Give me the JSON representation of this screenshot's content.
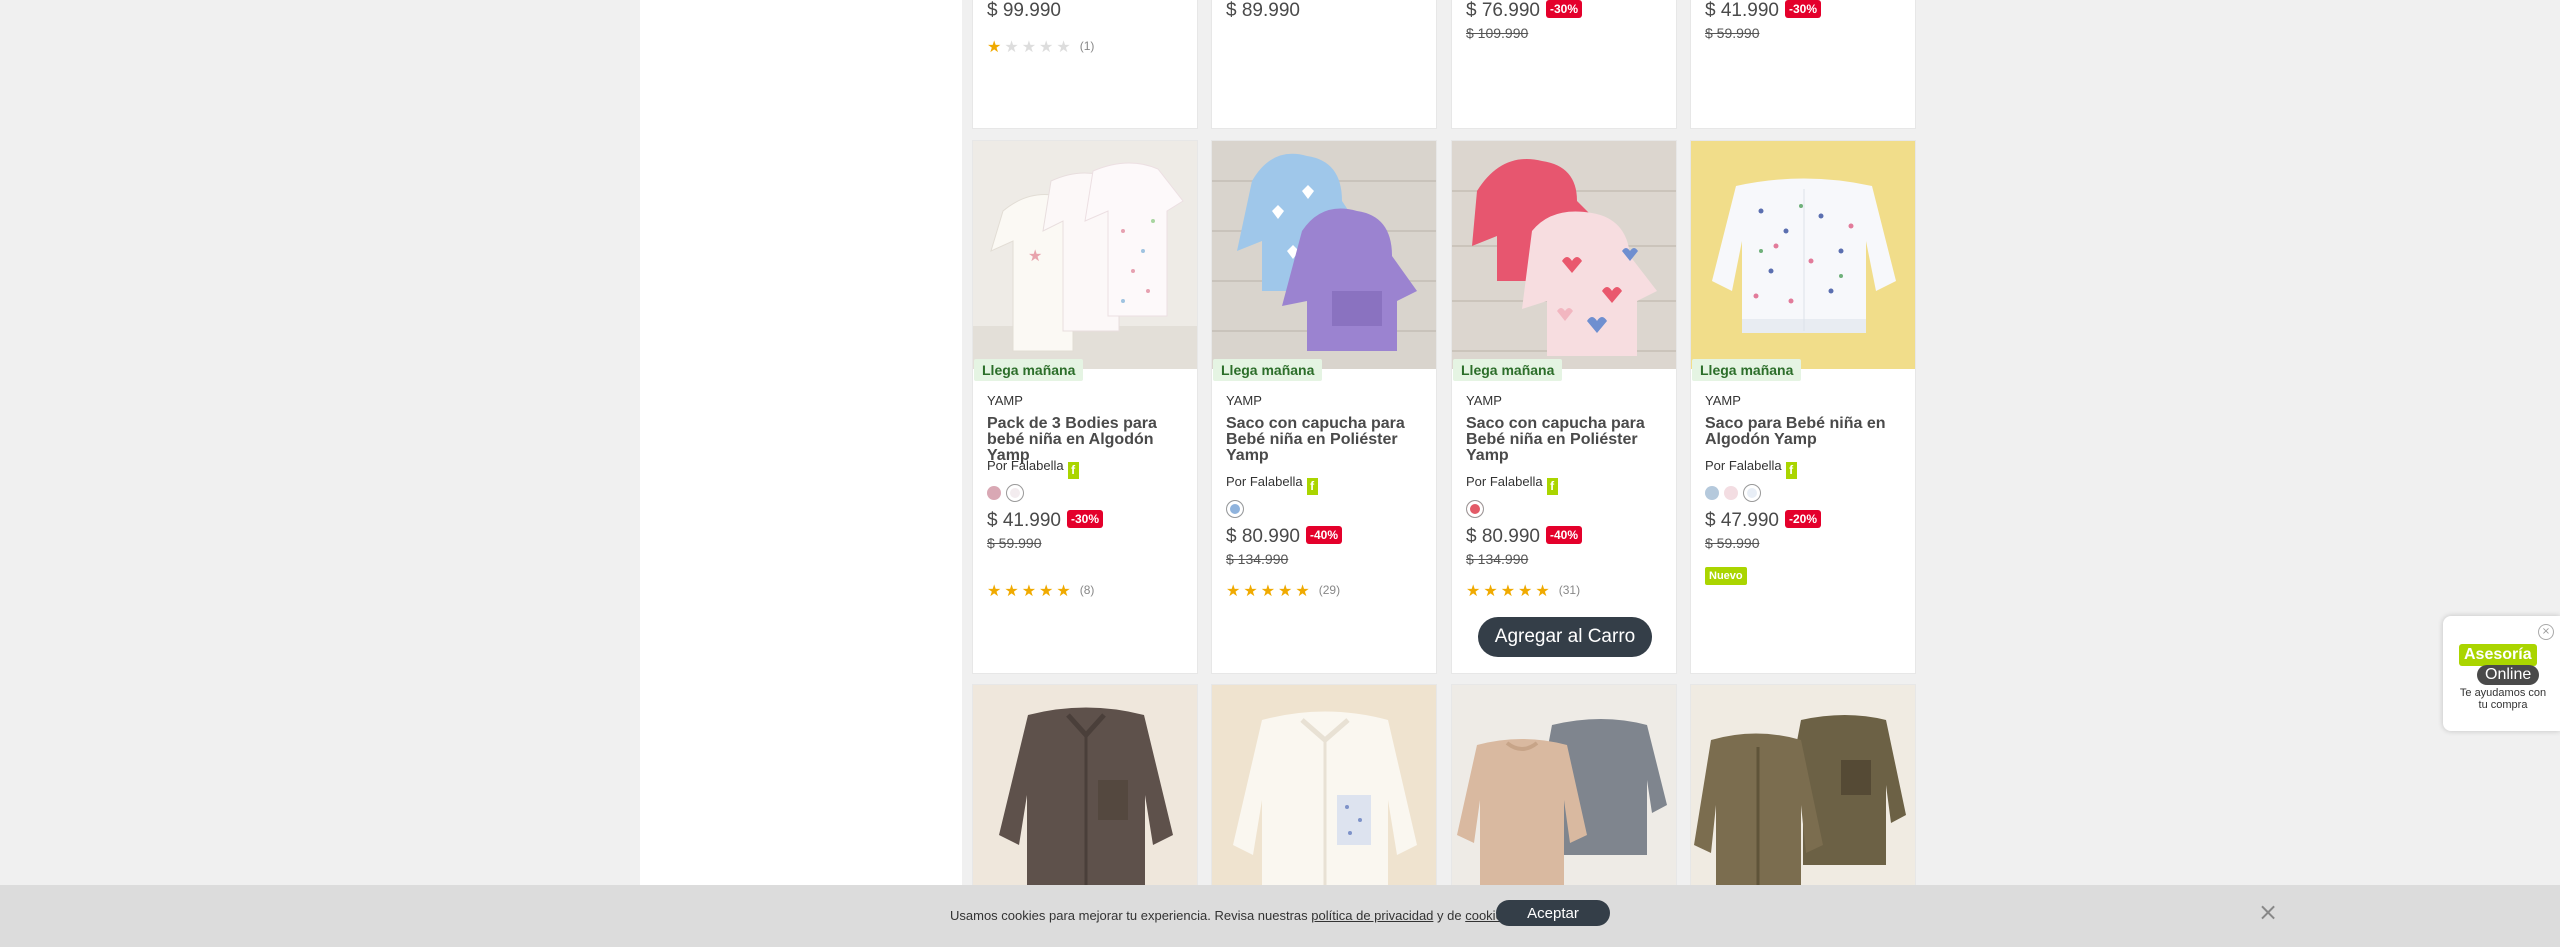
{
  "top_row": [
    {
      "price": "$ 99.990",
      "rating": {
        "filled": 1,
        "count": "(1)"
      }
    },
    {
      "price": "$ 89.990"
    },
    {
      "price": "$ 76.990",
      "discount": "-30%",
      "old_price": "$ 109.990"
    },
    {
      "price": "$ 41.990",
      "discount": "-30%",
      "old_price": "$ 59.990"
    }
  ],
  "middle_row": [
    {
      "shipping": "Llega mañana",
      "brand": "YAMP",
      "title": "Pack de 3 Bodies para bebé niña en Algodón Yamp",
      "seller": "Por Falabella",
      "colors": [
        "#d9a8b4",
        "#f3ecef"
      ],
      "price": "$ 41.990",
      "discount": "-30%",
      "old_price": "$ 59.990",
      "rating": {
        "filled": 5,
        "count": "(8)"
      }
    },
    {
      "shipping": "Llega mañana",
      "brand": "YAMP",
      "title": "Saco con capucha para Bebé niña en Poliéster Yamp",
      "seller": "Por Falabella",
      "colors": [
        "#8fb3dd"
      ],
      "price": "$ 80.990",
      "discount": "-40%",
      "old_price": "$ 134.990",
      "rating": {
        "filled": 5,
        "count": "(29)"
      }
    },
    {
      "shipping": "Llega mañana",
      "brand": "YAMP",
      "title": "Saco con capucha para Bebé niña en Poliéster Yamp",
      "seller": "Por Falabella",
      "colors": [
        "#e35a67"
      ],
      "price": "$ 80.990",
      "discount": "-40%",
      "old_price": "$ 134.990",
      "rating": {
        "filled": 5,
        "count": "(31)"
      },
      "add_to_cart": "Agregar al Carro"
    },
    {
      "shipping": "Llega mañana",
      "brand": "YAMP",
      "title": "Saco para Bebé niña en Algodón Yamp",
      "seller": "Por Falabella",
      "colors": [
        "#b5c9dc",
        "#f3dde2",
        "#e8eef6"
      ],
      "price": "$ 47.990",
      "discount": "-20%",
      "old_price": "$ 59.990",
      "tag": "Nuevo"
    }
  ],
  "seller_mark": "f",
  "cookie_bar": {
    "text_before": "Usamos cookies para mejorar tu experiencia. Revisa nuestras ",
    "privacy_link": "política de privacidad",
    "text_middle": " y de ",
    "cookies_link": "cookies",
    "text_after": ".",
    "accept": "Aceptar",
    "close": "×"
  },
  "help_widget": {
    "title": "Asesoría",
    "subtitle": "Online",
    "text": "Te ayudamos con tu compra",
    "close": "×"
  },
  "colors": {
    "brand_green": "#aad500",
    "discount_red": "#e4002b",
    "button_dark": "#343e48",
    "star": "#f0aa00"
  }
}
